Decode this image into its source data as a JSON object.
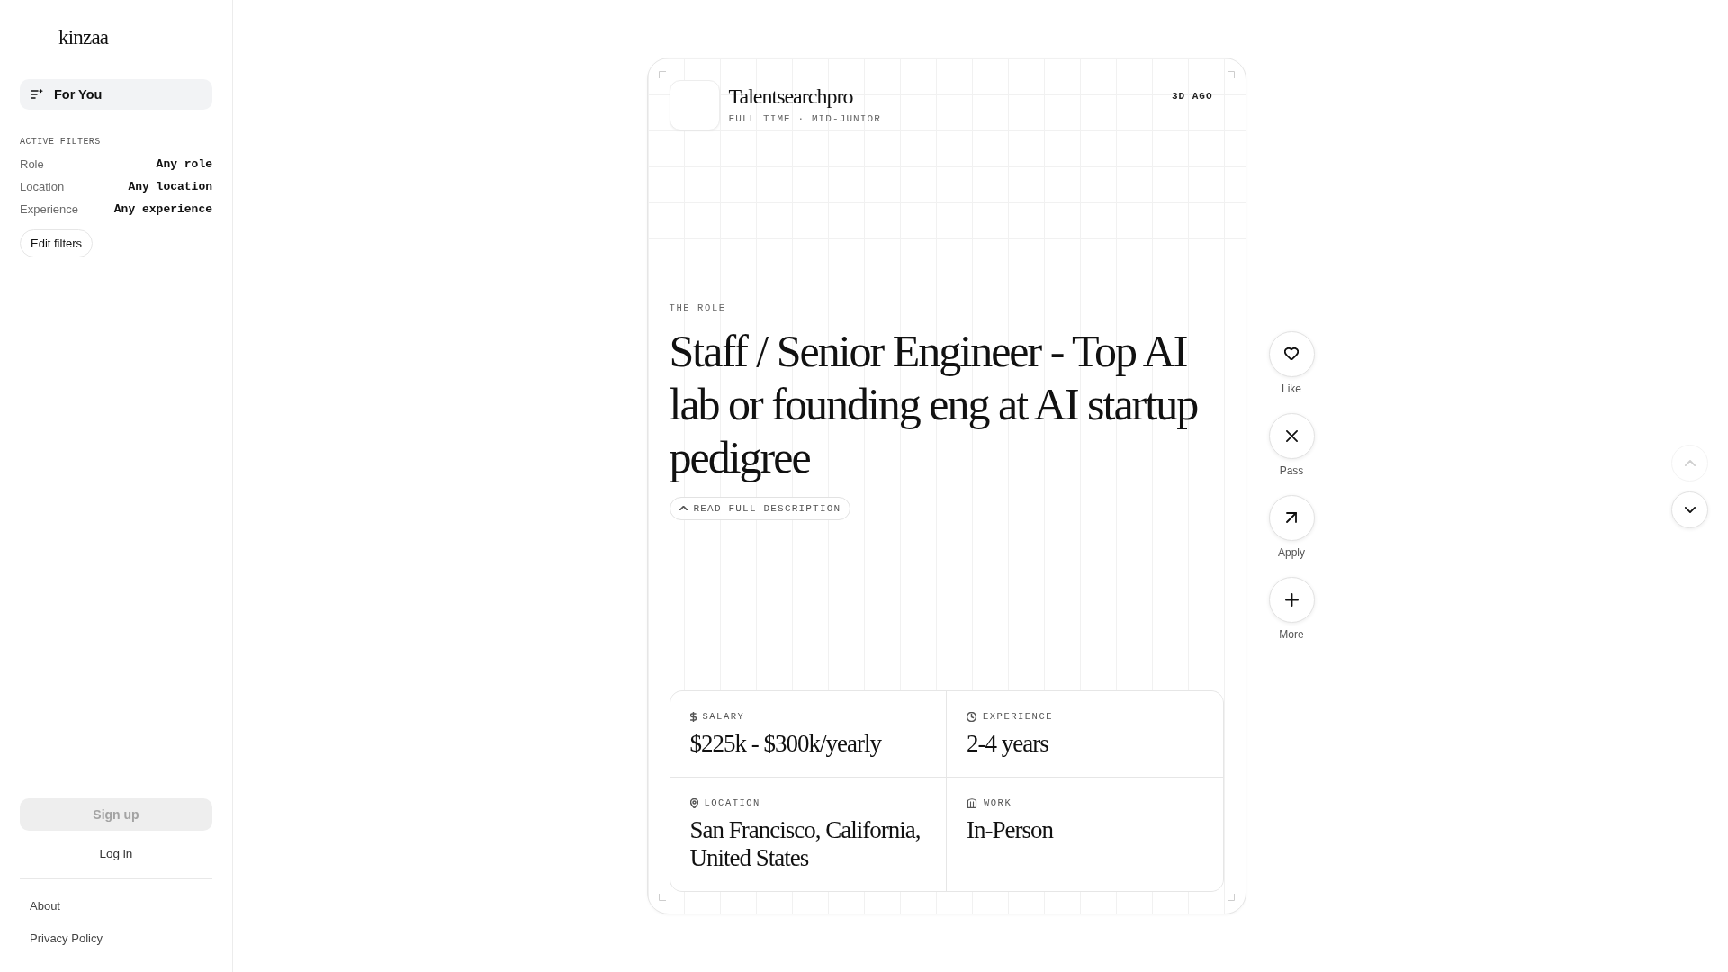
{
  "sidebar": {
    "logo": "kinzaa",
    "nav": [
      {
        "label": "For You",
        "selected": true
      }
    ],
    "filters": {
      "heading": "ACTIVE FILTERS",
      "rows": [
        {
          "label": "Role",
          "value": "Any role"
        },
        {
          "label": "Location",
          "value": "Any location"
        },
        {
          "label": "Experience",
          "value": "Any experience"
        }
      ]
    },
    "edit_button": "Edit filters",
    "sign_up": {
      "label": "Sign up",
      "disabled": true
    },
    "log_in": "Log in",
    "links": [
      "About",
      "Privacy Policy"
    ]
  },
  "job": {
    "company": "Talentsearchpro",
    "meta": "FULL TIME · MID-JUNIOR",
    "posted": "3D AGO",
    "section_label": "THE ROLE",
    "title": "Staff / Senior Engineer - Top AI lab or founding eng at AI startup pedigree",
    "read_more": "READ FULL DESCRIPTION",
    "facts": [
      {
        "kind": "salary",
        "label": "SALARY",
        "value": "$225k - $300k/yearly"
      },
      {
        "kind": "experience",
        "label": "EXPERIENCE",
        "value": "2-4 years"
      },
      {
        "kind": "location",
        "label": "LOCATION",
        "value": "San Francisco, California, United States"
      },
      {
        "kind": "work",
        "label": "WORK",
        "value": "In-Person"
      }
    ]
  },
  "actions": [
    {
      "kind": "like",
      "label": "Like"
    },
    {
      "kind": "pass",
      "label": "Pass"
    },
    {
      "kind": "apply",
      "label": "Apply"
    },
    {
      "kind": "more",
      "label": "More"
    }
  ],
  "scroll_nav": [
    {
      "kind": "up",
      "disabled": true
    },
    {
      "kind": "down",
      "disabled": false
    }
  ]
}
